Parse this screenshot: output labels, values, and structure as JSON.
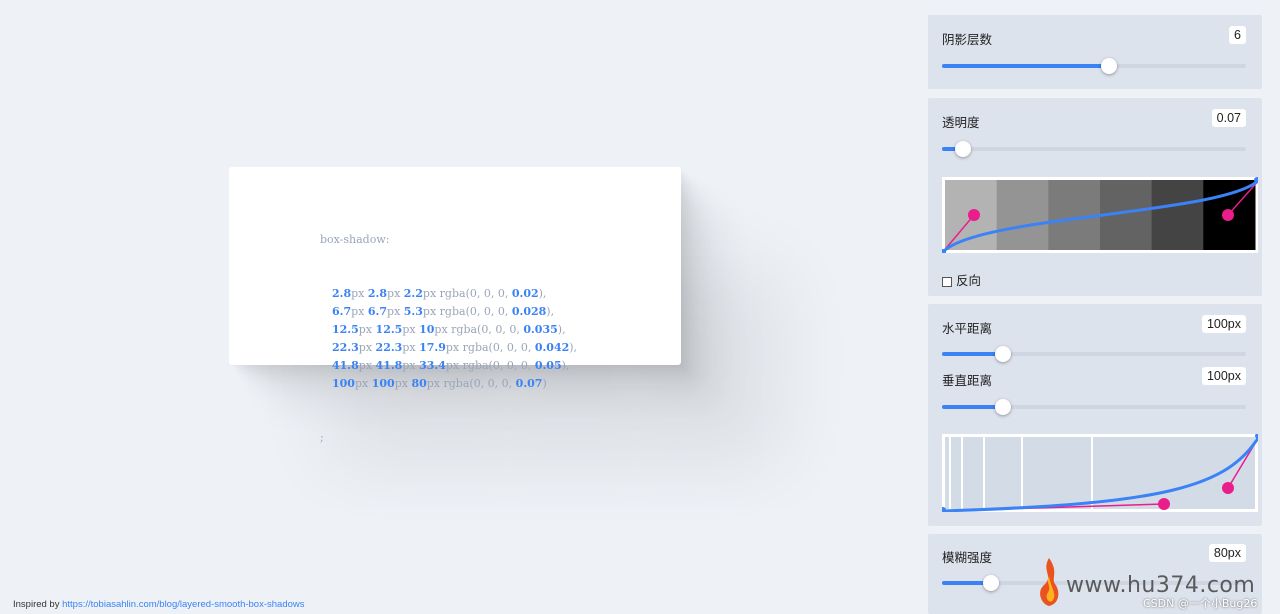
{
  "code": {
    "prop": "box-shadow:",
    "lines": [
      {
        "x": "2.8",
        "y": "2.8",
        "b": "2.2",
        "rgba": "rgba(0, 0, 0, ",
        "a": "0.02",
        "end": "),"
      },
      {
        "x": "6.7",
        "y": "6.7",
        "b": "5.3",
        "rgba": "rgba(0, 0, 0, ",
        "a": "0.028",
        "end": "),"
      },
      {
        "x": "12.5",
        "y": "12.5",
        "b": "10",
        "rgba": "rgba(0, 0, 0, ",
        "a": "0.035",
        "end": "),"
      },
      {
        "x": "22.3",
        "y": "22.3",
        "b": "17.9",
        "rgba": "rgba(0, 0, 0, ",
        "a": "0.042",
        "end": "),"
      },
      {
        "x": "41.8",
        "y": "41.8",
        "b": "33.4",
        "rgba": "rgba(0, 0, 0, ",
        "a": "0.05",
        "end": "),"
      },
      {
        "x": "100",
        "y": "100",
        "b": "80",
        "rgba": "rgba(0, 0, 0, ",
        "a": "0.07",
        "end": ")"
      }
    ],
    "unit": "px",
    "terminator": ";"
  },
  "footer": {
    "prefix": "Inspired by ",
    "link": "https://tobiasahlin.com/blog/layered-smooth-box-shadows"
  },
  "controls": {
    "layers": {
      "label": "阴影层数",
      "value": "6",
      "level": 0.55
    },
    "opacity": {
      "label": "透明度",
      "value": "0.07",
      "level": 0.07,
      "swatches": [
        "#b3b3b3",
        "#949494",
        "#7b7b7b",
        "#636363",
        "#444444",
        "#000000"
      ]
    },
    "reverse": {
      "label": "反向"
    },
    "offset_x": {
      "label": "水平距离",
      "value": "100px",
      "level": 0.2
    },
    "offset_y": {
      "label": "垂直距离",
      "value": "100px",
      "level": 0.2
    },
    "blur": {
      "label": "模糊强度",
      "value": "80px",
      "level": 0.16
    }
  },
  "colors": {
    "accent": "#3b82f6",
    "handle": "#e91e8c"
  },
  "watermark": {
    "site": "www.hu374.com",
    "csdn": "CSDN @一个小Bug26"
  }
}
